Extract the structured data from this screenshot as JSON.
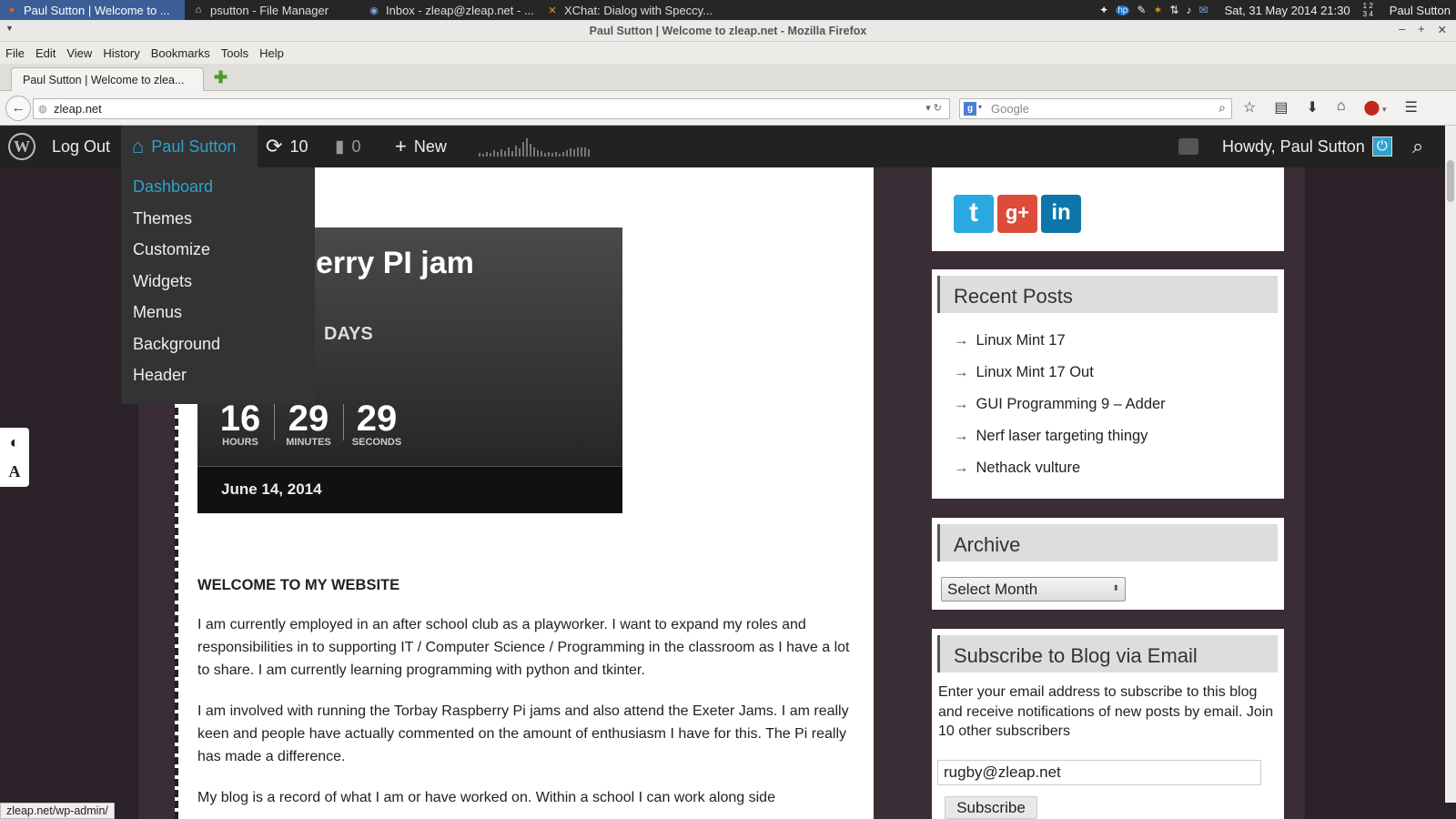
{
  "taskbar": {
    "tasks": [
      {
        "label": "Paul Sutton | Welcome to ...",
        "active": true
      },
      {
        "label": "psutton - File Manager"
      },
      {
        "label": "Inbox - zleap@zleap.net - ..."
      },
      {
        "label": "XChat: Dialog with Speccy..."
      }
    ],
    "datetime": "Sat, 31 May 2014 21:30",
    "workspaces": "1 2\n3 4",
    "user": "Paul Sutton"
  },
  "window": {
    "title": "Paul Sutton | Welcome to zleap.net - Mozilla Firefox"
  },
  "menubar": [
    "File",
    "Edit",
    "View",
    "History",
    "Bookmarks",
    "Tools",
    "Help"
  ],
  "tab": {
    "title": "Paul Sutton | Welcome to zlea..."
  },
  "url": "zleap.net",
  "search": {
    "placeholder": "Google"
  },
  "adminbar": {
    "logout": "Log Out",
    "site": "Paul Sutton",
    "updates": "10",
    "comments": "0",
    "new": "New",
    "howdy": "Howdy, Paul Sutton"
  },
  "dropdown": [
    "Dashboard",
    "Themes",
    "Customize",
    "Widgets",
    "Menus",
    "Background",
    "Header"
  ],
  "countdown": {
    "title": "erry PI jam",
    "days_label": "DAYS",
    "hours": "16",
    "hours_label": "HOURS",
    "minutes": "29",
    "minutes_label": "MINUTES",
    "seconds": "29",
    "seconds_label": "SECONDS",
    "date": "June 14, 2014"
  },
  "article": {
    "heading": "WELCOME TO MY WEBSITE",
    "p1": "I am currently employed in an after school club as a playworker. I want to expand my roles and responsibilities in to supporting IT / Computer Science / Programming in the classroom as I have a lot to share.  I am currently learning programming with python and tkinter.",
    "p2": "I am involved with running the Torbay Raspberry Pi jams and also attend the Exeter Jams.  I am really keen and people have actually commented on the amount of enthusiasm I have for this.  The Pi really has made a difference.",
    "p3": "My blog is a record of what I am or have worked on.  Within a school I can work along side"
  },
  "sidebar": {
    "recent_title": "Recent Posts",
    "recent": [
      "Linux Mint 17",
      "Linux Mint 17 Out",
      "GUI Programming 9 – Adder",
      "Nerf laser targeting thingy",
      "Nethack vulture"
    ],
    "archive_title": "Archive",
    "archive_select": "Select Month",
    "subscribe_title": "Subscribe to Blog via Email",
    "subscribe_text": "Enter your email address to subscribe to this blog and receive notifications of new posts by email.  Join 10 other subscribers",
    "email_value": "rugby@zleap.net",
    "subscribe_button": "Subscribe"
  },
  "status_url": "zleap.net/wp-admin/",
  "colors": {
    "wp_blue": "#2ea2cc",
    "adminbar": "#222222",
    "twitter": "#2aa9e0",
    "gplus": "#dd4b39",
    "linkedin": "#0e76a8"
  }
}
